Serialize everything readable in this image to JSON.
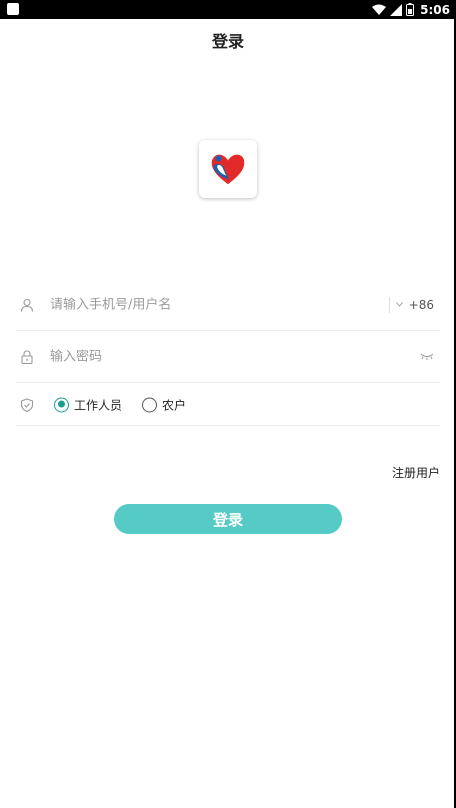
{
  "status_bar": {
    "time": "5:06"
  },
  "header": {
    "title": "登录"
  },
  "form": {
    "username_placeholder": "请输入手机号/用户名",
    "country_code": "+86",
    "password_placeholder": "输入密码",
    "roles": [
      {
        "label": "工作人员",
        "selected": true
      },
      {
        "label": "农户",
        "selected": false
      }
    ]
  },
  "links": {
    "register": "注册用户"
  },
  "actions": {
    "login_label": "登录"
  },
  "colors": {
    "accent": "#56cbc6",
    "radio_checked": "#1a9f8f"
  }
}
